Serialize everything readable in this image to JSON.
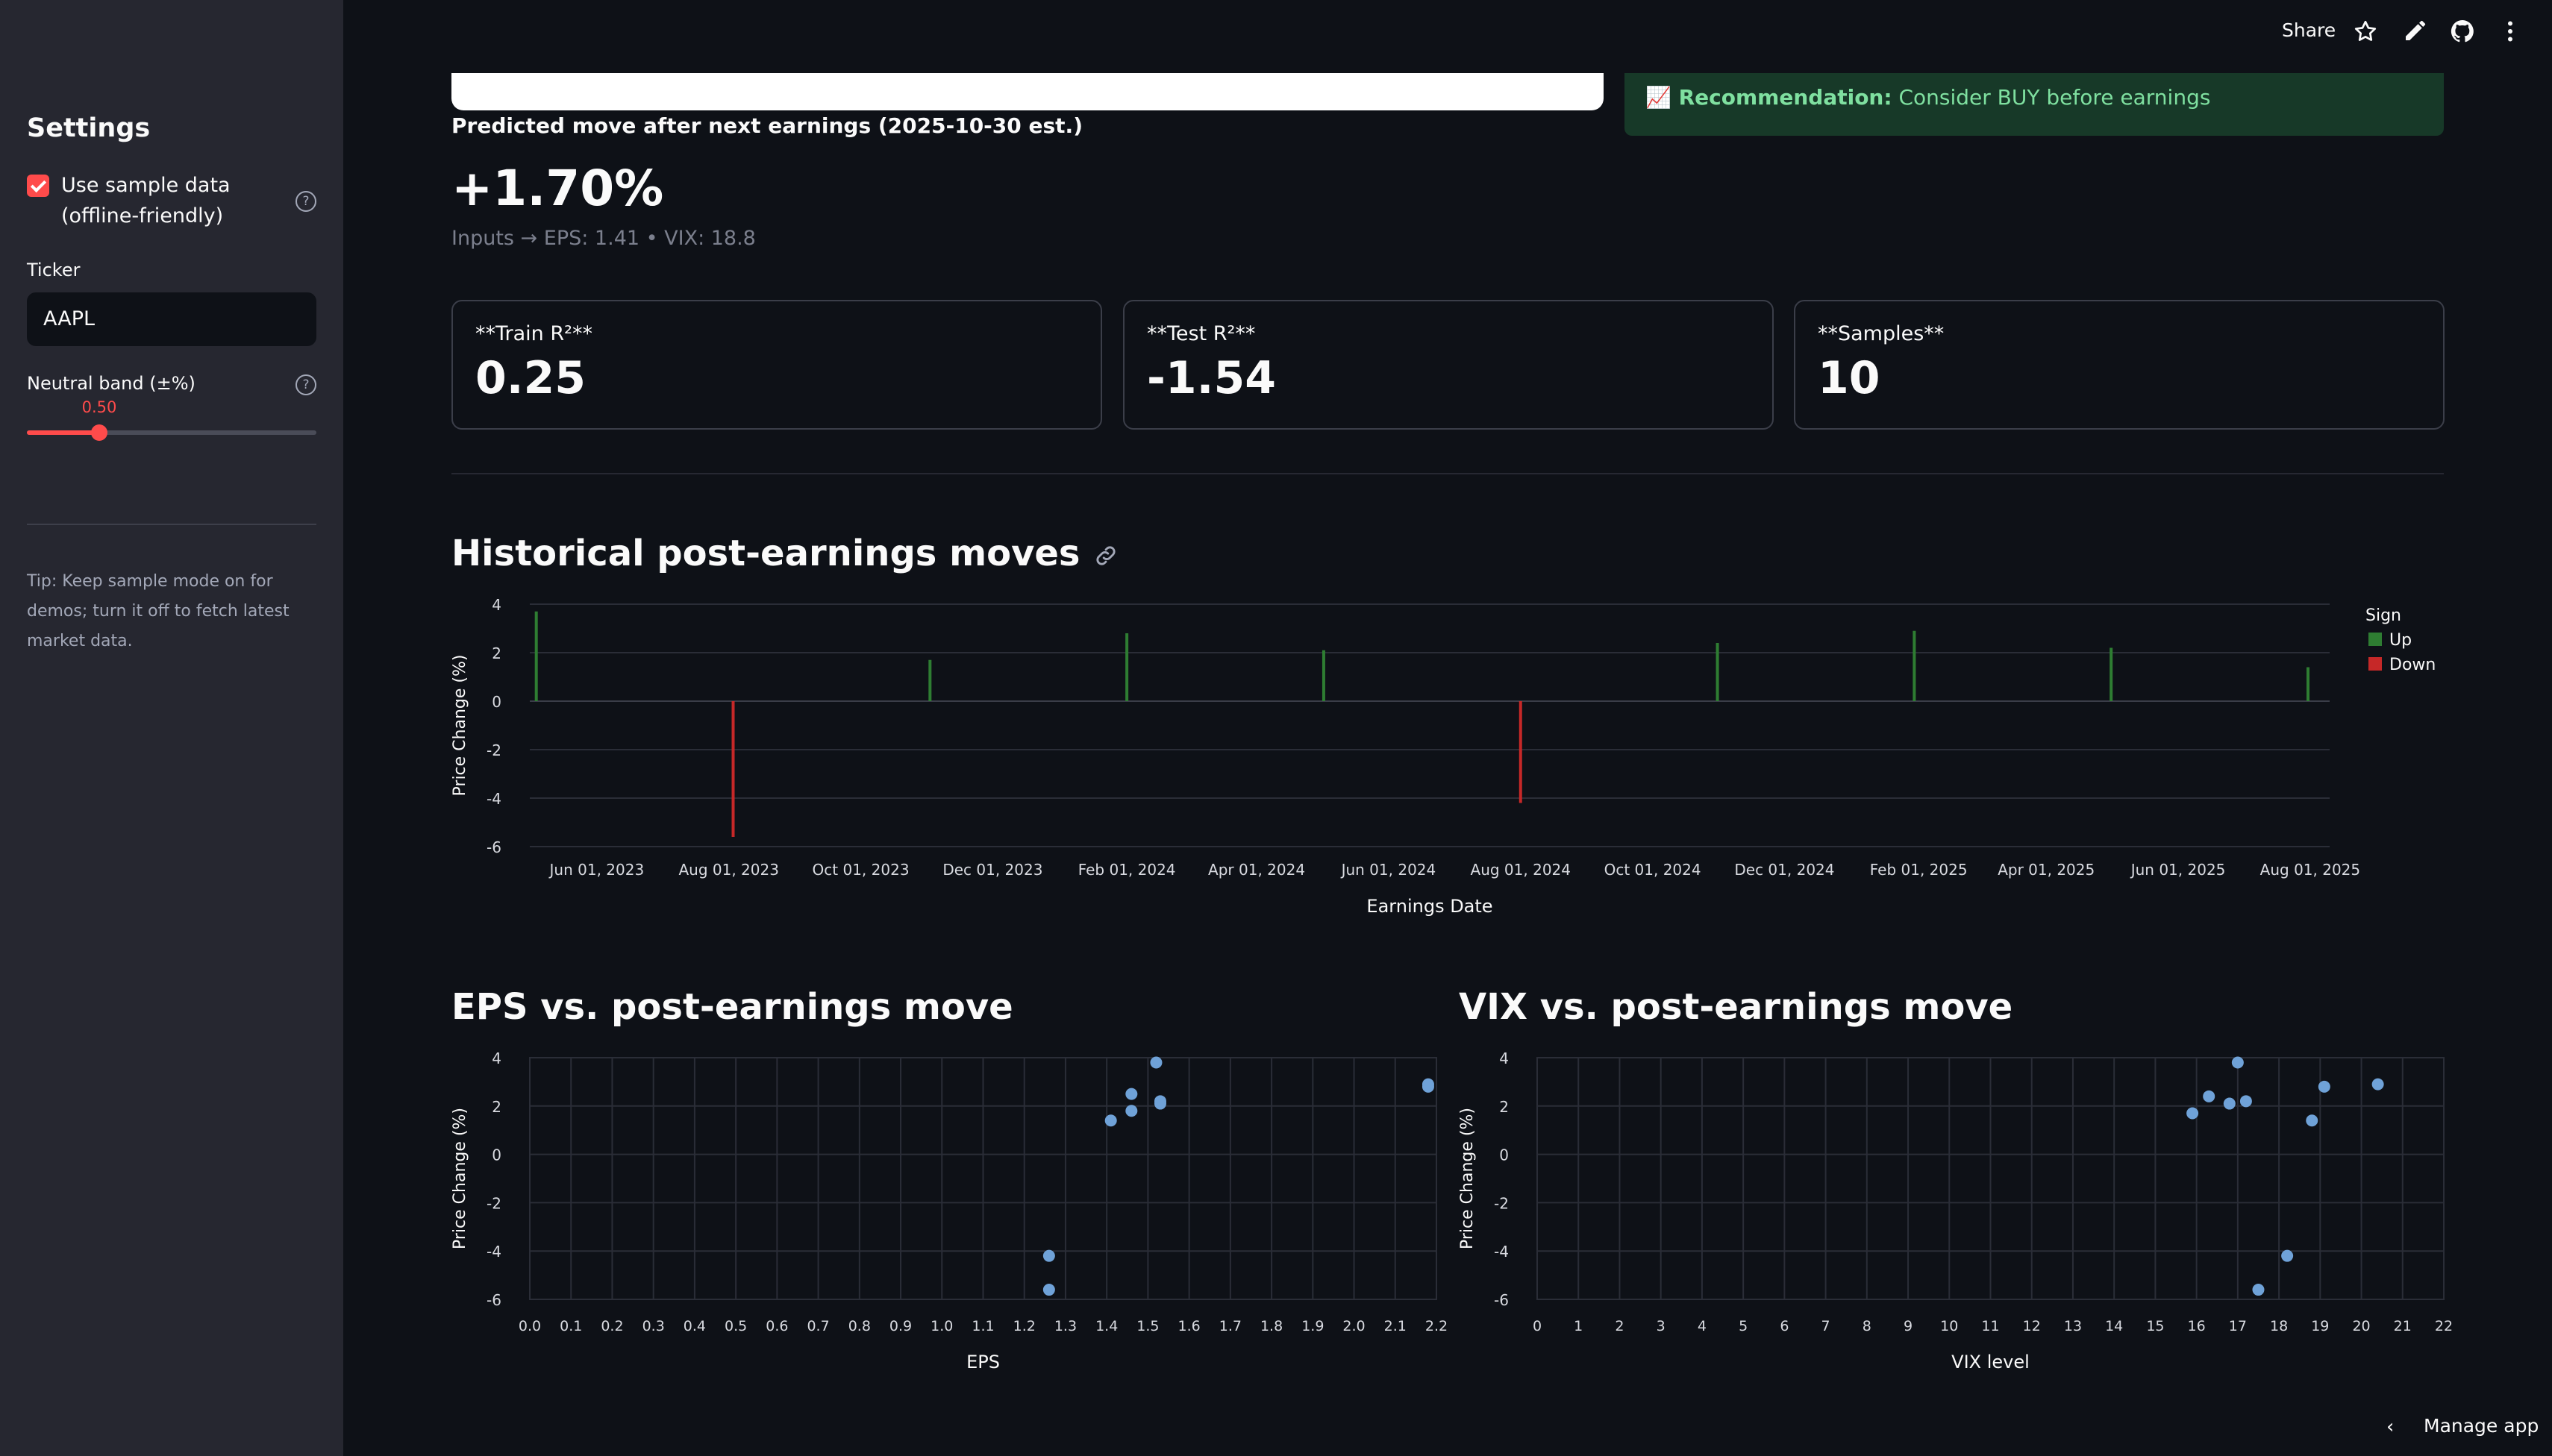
{
  "sidebar": {
    "title": "Settings",
    "sample_data_label": "Use sample data (offline-friendly)",
    "sample_data_checked": true,
    "ticker_label": "Ticker",
    "ticker_value": "AAPL",
    "neutral_band_label": "Neutral band (±%)",
    "neutral_band_value": "0.50",
    "neutral_band_fraction": 0.25,
    "tip": "Tip: Keep sample mode on for demos; turn it off to fetch latest market data."
  },
  "toolbar": {
    "share_label": "Share",
    "icons": [
      "star-icon",
      "edit-icon",
      "github-icon",
      "more-vert-icon"
    ]
  },
  "main": {
    "recommendation_prefix": "📈 Recommendation:",
    "recommendation_text": "Consider BUY before earnings",
    "prediction_label": "Predicted move after next earnings (2025-10-30 est.)",
    "prediction_value": "+1.70%",
    "prediction_inputs": "Inputs → EPS: 1.41 • VIX: 18.8",
    "metrics": [
      {
        "label": "**Train R²**",
        "value": "0.25"
      },
      {
        "label": "**Test R²**",
        "value": "-1.54"
      },
      {
        "label": "**Samples**",
        "value": "10"
      }
    ],
    "historical_title": "Historical post-earnings moves",
    "eps_title": "EPS vs. post-earnings move",
    "vix_title": "VIX vs. post-earnings move"
  },
  "footer": {
    "manage_label": "Manage app"
  },
  "colors": {
    "up": "#2e7d32",
    "down": "#c62828",
    "point": "#6fa2d8",
    "accent": "#ff4b4b"
  },
  "chart_data": [
    {
      "type": "bar",
      "title": "Historical post-earnings moves",
      "xlabel": "Earnings Date",
      "ylabel": "Price Change (%)",
      "ylim": [
        -6,
        4
      ],
      "yticks": [
        4,
        2,
        0,
        -2,
        -4,
        -6
      ],
      "xticks": [
        "Jun 01, 2023",
        "Aug 01, 2023",
        "Oct 01, 2023",
        "Dec 01, 2023",
        "Feb 01, 2024",
        "Apr 01, 2024",
        "Jun 01, 2024",
        "Aug 01, 2024",
        "Oct 01, 2024",
        "Dec 01, 2024",
        "Feb 01, 2025",
        "Apr 01, 2025",
        "Jun 01, 2025",
        "Aug 01, 2025"
      ],
      "legend_title": "Sign",
      "legend": [
        {
          "name": "Up",
          "color": "#2e7d32"
        },
        {
          "name": "Down",
          "color": "#c62828"
        }
      ],
      "legend_position": "top-right",
      "grid": true,
      "points": [
        {
          "date": "2023-05-04",
          "value": 3.7,
          "sign": "Up"
        },
        {
          "date": "2023-08-03",
          "value": -5.6,
          "sign": "Down"
        },
        {
          "date": "2023-11-02",
          "value": 1.7,
          "sign": "Up"
        },
        {
          "date": "2024-02-01",
          "value": 2.8,
          "sign": "Up"
        },
        {
          "date": "2024-05-02",
          "value": 2.1,
          "sign": "Up"
        },
        {
          "date": "2024-08-01",
          "value": -4.2,
          "sign": "Down"
        },
        {
          "date": "2024-10-31",
          "value": 2.4,
          "sign": "Up"
        },
        {
          "date": "2025-01-30",
          "value": 2.9,
          "sign": "Up"
        },
        {
          "date": "2025-05-01",
          "value": 2.2,
          "sign": "Up"
        },
        {
          "date": "2025-07-31",
          "value": 1.4,
          "sign": "Up"
        }
      ]
    },
    {
      "type": "scatter",
      "title": "EPS vs. post-earnings move",
      "xlabel": "EPS",
      "ylabel": "Price Change (%)",
      "xlim": [
        0,
        2.2
      ],
      "ylim": [
        -6,
        4
      ],
      "xticks": [
        "0.0",
        "0.1",
        "0.2",
        "0.3",
        "0.4",
        "0.5",
        "0.6",
        "0.7",
        "0.8",
        "0.9",
        "1.0",
        "1.1",
        "1.2",
        "1.3",
        "1.4",
        "1.5",
        "1.6",
        "1.7",
        "1.8",
        "1.9",
        "2.0",
        "2.1",
        "2.2"
      ],
      "yticks": [
        4,
        2,
        0,
        -2,
        -4,
        -6
      ],
      "grid": true,
      "x": [
        1.26,
        1.26,
        1.41,
        1.46,
        1.46,
        1.52,
        1.53,
        1.53,
        2.18,
        2.18
      ],
      "y": [
        -4.2,
        -5.6,
        1.4,
        2.5,
        1.8,
        3.8,
        2.1,
        2.2,
        2.8,
        2.9
      ]
    },
    {
      "type": "scatter",
      "title": "VIX vs. post-earnings move",
      "xlabel": "VIX level",
      "ylabel": "Price Change (%)",
      "xlim": [
        0,
        22
      ],
      "ylim": [
        -6,
        4
      ],
      "xticks": [
        "0",
        "1",
        "2",
        "3",
        "4",
        "5",
        "6",
        "7",
        "8",
        "9",
        "10",
        "11",
        "12",
        "13",
        "14",
        "15",
        "16",
        "17",
        "18",
        "19",
        "20",
        "21",
        "22"
      ],
      "yticks": [
        4,
        2,
        0,
        -2,
        -4,
        -6
      ],
      "grid": true,
      "x": [
        15.9,
        16.3,
        16.8,
        17.0,
        17.2,
        17.5,
        18.2,
        18.8,
        19.1,
        20.4
      ],
      "y": [
        1.7,
        2.4,
        2.1,
        3.8,
        2.2,
        -5.6,
        -4.2,
        1.4,
        2.8,
        2.9
      ]
    }
  ]
}
